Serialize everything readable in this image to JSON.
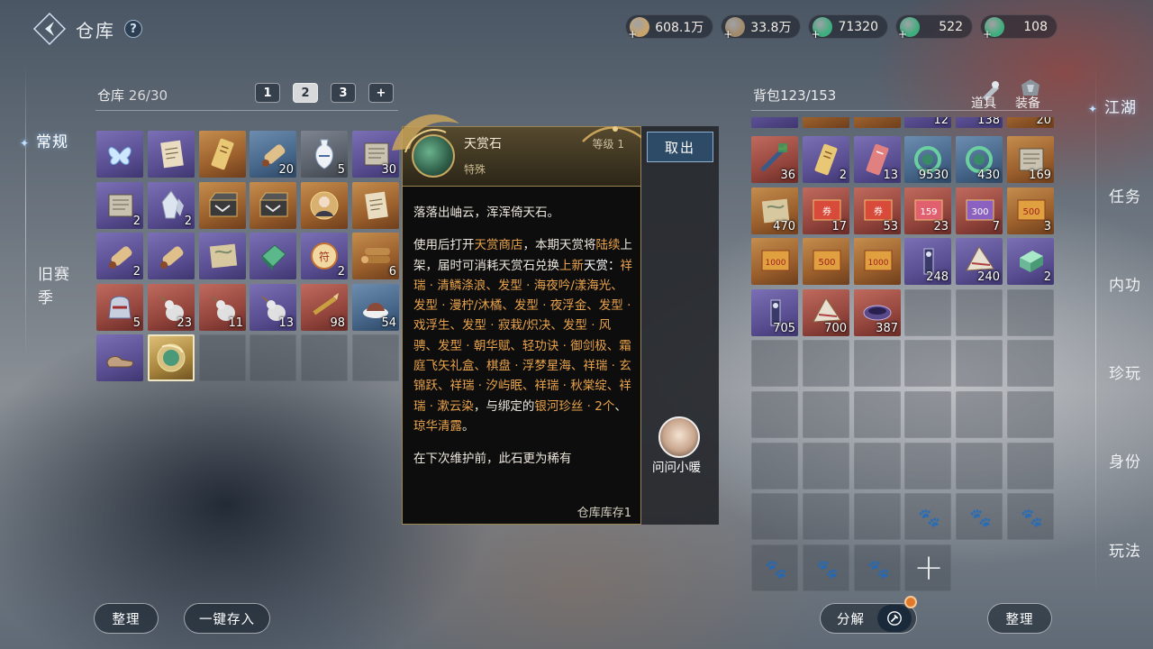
{
  "header": {
    "title": "仓库",
    "help": "?"
  },
  "currencies": [
    {
      "icon": "scroll-coin-icon",
      "value": "608.1万",
      "color": "#c9a46a"
    },
    {
      "icon": "bronze-coin-icon",
      "value": "33.8万",
      "color": "#a38a6a"
    },
    {
      "icon": "jade-bag-icon",
      "value": "71320",
      "color": "#3fae7e"
    },
    {
      "icon": "jade-gem-icon",
      "value": "522",
      "color": "#3fae7e"
    },
    {
      "icon": "jade-orb-icon",
      "value": "108",
      "color": "#3fae7e"
    }
  ],
  "left_tabs": [
    {
      "label": "常规",
      "active": true
    },
    {
      "label": "旧赛",
      "label2": "季",
      "active": false
    }
  ],
  "warehouse": {
    "label": "仓库",
    "count": "26/30",
    "pages": [
      "1",
      "2",
      "3"
    ],
    "items": [
      {
        "q": "purple",
        "icon": "butterfly-icon",
        "qty": ""
      },
      {
        "q": "purple",
        "icon": "paper-icon",
        "qty": ""
      },
      {
        "q": "orange",
        "icon": "ticket-icon",
        "qty": ""
      },
      {
        "q": "blue",
        "icon": "scroll-icon",
        "qty": "20"
      },
      {
        "q": "gray",
        "icon": "vase-icon",
        "qty": "5"
      },
      {
        "q": "purple",
        "icon": "book-icon",
        "qty": "30"
      },
      {
        "q": "purple",
        "icon": "book-icon",
        "qty": "2"
      },
      {
        "q": "purple",
        "icon": "crystal-icon",
        "qty": "2"
      },
      {
        "q": "orange",
        "icon": "chest-icon",
        "qty": ""
      },
      {
        "q": "orange",
        "icon": "chest-icon",
        "qty": ""
      },
      {
        "q": "orange",
        "icon": "portrait-icon",
        "qty": ""
      },
      {
        "q": "orange",
        "icon": "paper-icon",
        "qty": ""
      },
      {
        "q": "purple",
        "icon": "scroll-icon",
        "qty": "2"
      },
      {
        "q": "purple",
        "icon": "scroll-icon",
        "qty": ""
      },
      {
        "q": "purple",
        "icon": "map-icon",
        "qty": ""
      },
      {
        "q": "purple",
        "icon": "jade-bar-icon",
        "qty": ""
      },
      {
        "q": "purple",
        "icon": "token-icon",
        "qty": "2"
      },
      {
        "q": "orange",
        "icon": "logs-icon",
        "qty": "6"
      },
      {
        "q": "red",
        "icon": "bag-icon",
        "qty": "5"
      },
      {
        "q": "red",
        "icon": "gourd-icon",
        "qty": "23"
      },
      {
        "q": "red",
        "icon": "gourd-icon",
        "qty": "11"
      },
      {
        "q": "purple",
        "icon": "gourd-icon",
        "qty": "13"
      },
      {
        "q": "red",
        "icon": "brush-icon",
        "qty": "98"
      },
      {
        "q": "blue",
        "icon": "dumpling-icon",
        "qty": "54"
      },
      {
        "q": "purple",
        "icon": "shoes-icon",
        "qty": ""
      },
      {
        "q": "gold",
        "icon": "sky-stone-icon",
        "qty": "",
        "selected": true
      }
    ]
  },
  "tooltip": {
    "name": "天赏石",
    "level": "等级 1",
    "type": "特殊",
    "line1": "落落出岫云，浑浑倚天石。",
    "desc_parts": [
      {
        "t": "使用后打开",
        "c": ""
      },
      {
        "t": "天赏商店",
        "c": "hl"
      },
      {
        "t": "，本期天赏将",
        "c": ""
      },
      {
        "t": "陆续",
        "c": "hl"
      },
      {
        "t": "上架，届时可消耗天赏石兑换",
        "c": ""
      },
      {
        "t": "上新",
        "c": "hl"
      },
      {
        "t": "天赏：",
        "c": "w"
      },
      {
        "t": "祥瑞 · 清鳞涤浪、发型 · 海夜吟/漾海光、发型 · 漫柠/沐橘、发型 · 夜浮金、发型 · 戏浮生、发型 · 寂栽/炽决、发型 · 风骋、发型 · 朝华赋、轻功诀 · 御剑极、霜庭飞矢礼盒、棋盘 · 浮梦星海、祥瑞 · 玄锦跃、祥瑞 · 汐屿眠、祥瑞 · 秋棠绽、祥瑞 · 漱云染",
        "c": "hl"
      },
      {
        "t": "，与绑定的",
        "c": ""
      },
      {
        "t": "银河珍丝 · 2个",
        "c": "hl"
      },
      {
        "t": "、",
        "c": ""
      },
      {
        "t": "琼华清露",
        "c": "hl"
      },
      {
        "t": "。",
        "c": ""
      }
    ],
    "line3": "在下次维护前，此石更为稀有",
    "stock": "仓库库存1",
    "take_out": "取出",
    "ask_label": "问问小暖"
  },
  "backpack": {
    "label": "背包",
    "count": "123/153",
    "tab_items": "道具",
    "tab_equip": "装备",
    "partial_row": [
      {
        "q": "purple",
        "qty": ""
      },
      {
        "q": "orange",
        "qty": ""
      },
      {
        "q": "orange",
        "qty": ""
      },
      {
        "q": "purple",
        "qty": "12"
      },
      {
        "q": "purple",
        "qty": "138"
      },
      {
        "q": "orange",
        "qty": "20"
      }
    ],
    "items": [
      {
        "q": "red",
        "icon": "sword-icon",
        "qty": "36"
      },
      {
        "q": "purple",
        "icon": "ticket-icon",
        "qty": "2"
      },
      {
        "q": "purple",
        "icon": "ticket-red-icon",
        "qty": "13"
      },
      {
        "q": "blue",
        "icon": "jade-swirl-icon",
        "qty": "9530"
      },
      {
        "q": "blue",
        "icon": "jade-swirl-icon",
        "qty": "430"
      },
      {
        "q": "orange",
        "icon": "book-icon",
        "qty": "169"
      },
      {
        "q": "orange",
        "icon": "map-icon",
        "qty": "470"
      },
      {
        "q": "red",
        "icon": "coupon-icon",
        "qty": "17"
      },
      {
        "q": "red",
        "icon": "coupon-icon",
        "qty": "53"
      },
      {
        "q": "red",
        "icon": "coupon-159-icon",
        "qty": "23"
      },
      {
        "q": "red",
        "icon": "coupon-300-icon",
        "qty": "7"
      },
      {
        "q": "orange",
        "icon": "coupon-500-icon",
        "qty": "3"
      },
      {
        "q": "orange",
        "icon": "coupon-1000-icon",
        "qty": ""
      },
      {
        "q": "orange",
        "icon": "coupon-500-icon",
        "qty": ""
      },
      {
        "q": "orange",
        "icon": "coupon-1000-icon",
        "qty": ""
      },
      {
        "q": "purple",
        "icon": "talisman-icon",
        "qty": "248"
      },
      {
        "q": "purple",
        "icon": "fan-icon",
        "qty": "240"
      },
      {
        "q": "purple",
        "icon": "jade-box-icon",
        "qty": "2"
      },
      {
        "q": "purple",
        "icon": "talisman-icon",
        "qty": "705"
      },
      {
        "q": "red",
        "icon": "fan-icon",
        "qty": "700"
      },
      {
        "q": "red",
        "icon": "bowl-icon",
        "qty": "387"
      }
    ]
  },
  "right_tabs": [
    {
      "label": "江湖",
      "active": true
    },
    {
      "label": "任务"
    },
    {
      "label": "内功"
    },
    {
      "label": "珍玩"
    },
    {
      "label": "身份"
    },
    {
      "label": "玩法"
    }
  ],
  "buttons": {
    "sort_left": "整理",
    "deposit_all": "一键存入",
    "decompose": "分解",
    "sort_right": "整理"
  }
}
